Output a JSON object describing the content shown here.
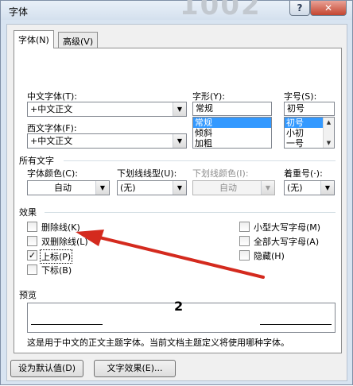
{
  "window": {
    "title": "字体",
    "background_number": "1002",
    "help_glyph": "?",
    "close_glyph": "✕"
  },
  "tabs": [
    {
      "label": "字体(N)",
      "active": true
    },
    {
      "label": "高级(V)",
      "active": false
    }
  ],
  "font_section": {
    "chinese_font_label": "中文字体(T):",
    "chinese_font_value": "+中文正文",
    "western_font_label": "西文字体(F):",
    "western_font_value": "+中文正文",
    "style_label": "字形(Y):",
    "style_value": "常规",
    "style_options": [
      "常规",
      "倾斜",
      "加粗"
    ],
    "size_label": "字号(S):",
    "size_value": "初号",
    "size_options": [
      "初号",
      "小初",
      "一号"
    ]
  },
  "all_text": {
    "header": "所有文字",
    "font_color_label": "字体颜色(C):",
    "font_color_value": "自动",
    "underline_type_label": "下划线线型(U):",
    "underline_type_value": "(无)",
    "underline_color_label": "下划线颜色(I):",
    "underline_color_value": "自动",
    "emphasis_label": "着重号(·):",
    "emphasis_value": "(无)"
  },
  "effects": {
    "header": "效果",
    "items": [
      {
        "label": "删除线(K)",
        "checked": false
      },
      {
        "label": "双删除线(L)",
        "checked": false
      },
      {
        "label": "上标(P)",
        "checked": true
      },
      {
        "label": "下标(B)",
        "checked": false
      },
      {
        "label": "小型大写字母(M)",
        "checked": false
      },
      {
        "label": "全部大写字母(A)",
        "checked": false
      },
      {
        "label": "隐藏(H)",
        "checked": false
      }
    ]
  },
  "preview": {
    "header": "预览",
    "sample": "2",
    "description": "这是用于中文的正文主题字体。当前文档主题定义将使用哪种字体。"
  },
  "buttons": {
    "set_default": "设为默认值(D)",
    "text_effects": "文字效果(E)..."
  },
  "colors": {
    "arrow": "#d42a1e",
    "selection": "#3399ff",
    "close_button": "#c3442f"
  }
}
